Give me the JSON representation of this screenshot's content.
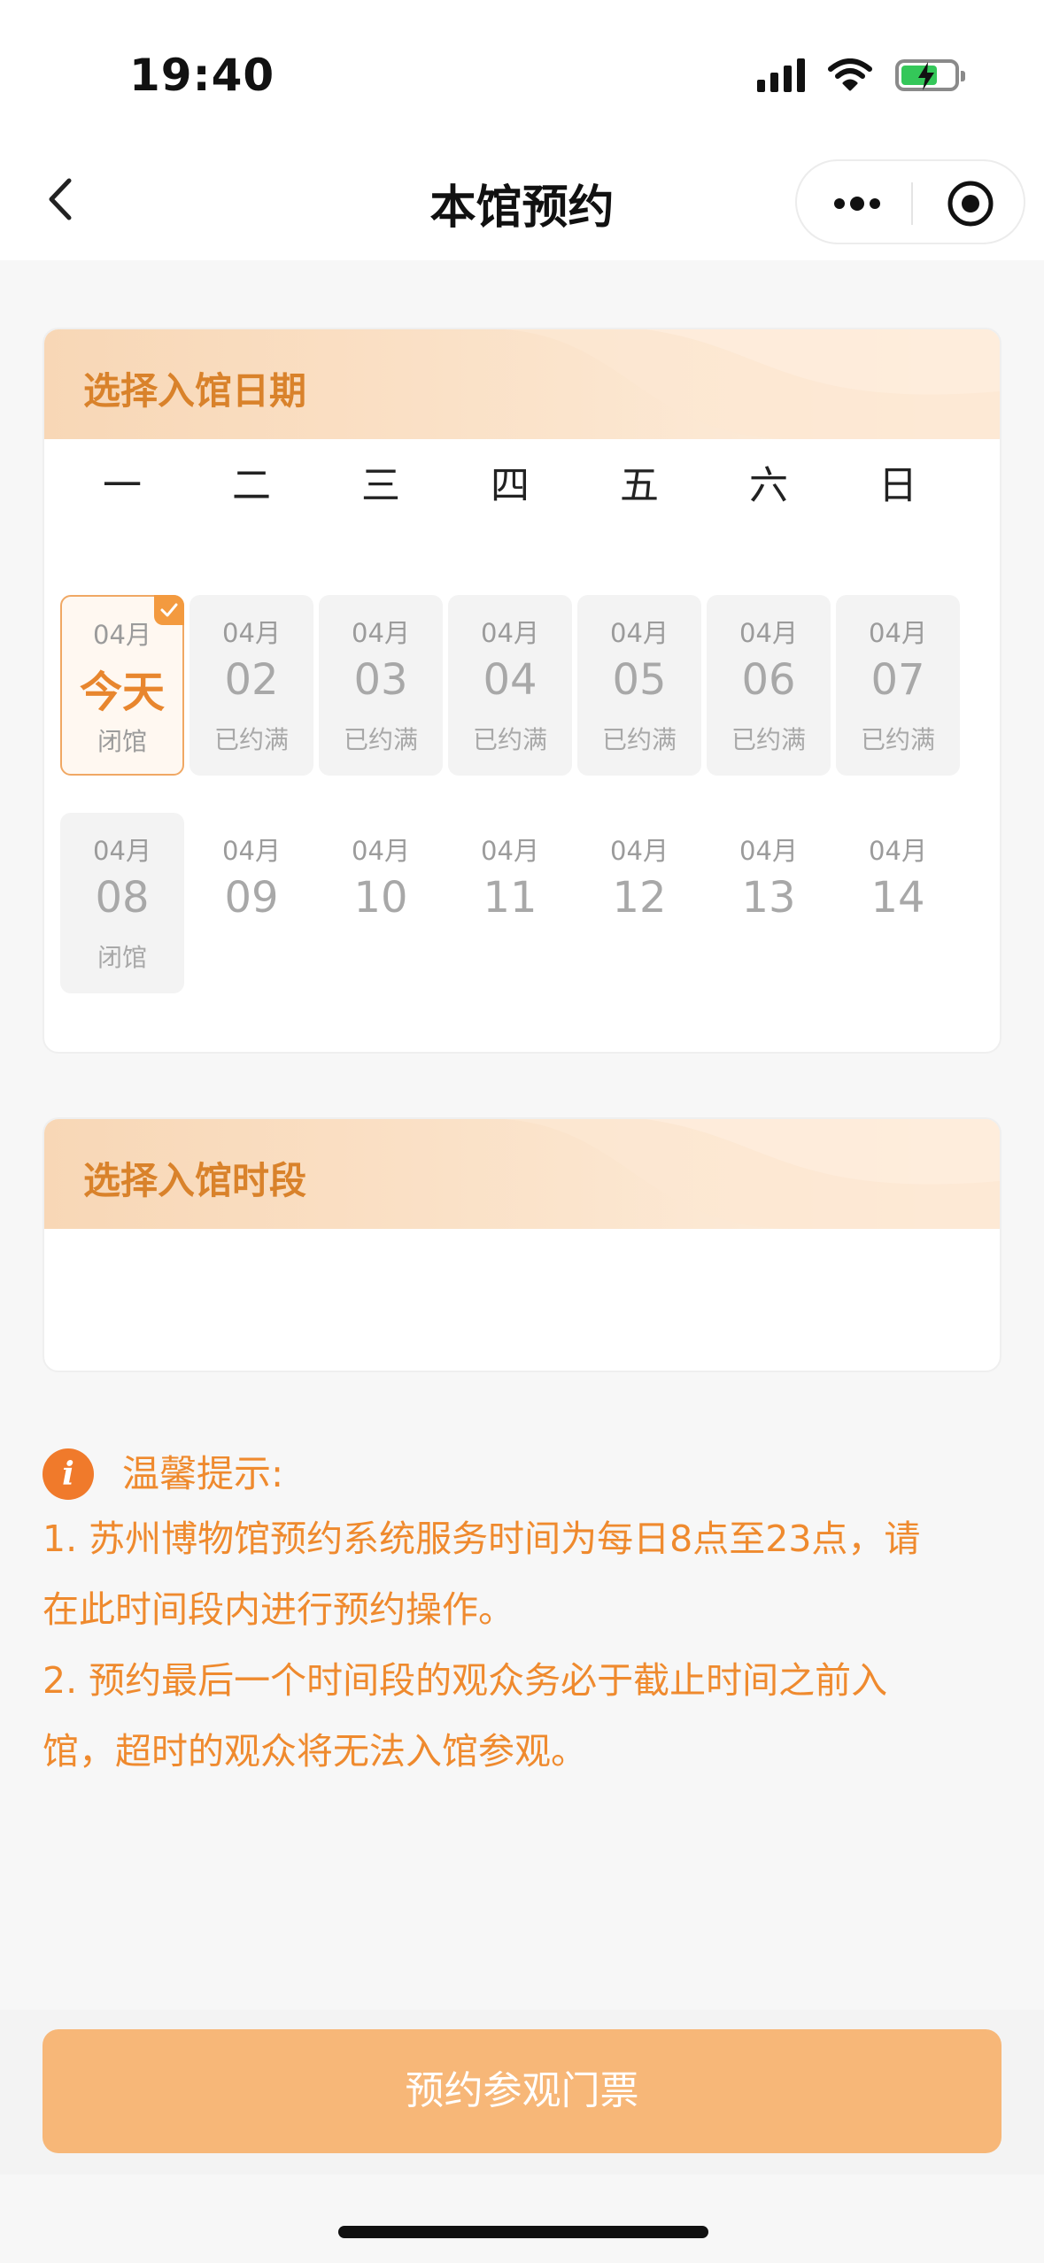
{
  "status_bar": {
    "time": "19:40"
  },
  "nav": {
    "title": "本馆预约"
  },
  "date_section": {
    "title": "选择入馆日期",
    "weekdays": [
      "一",
      "二",
      "三",
      "四",
      "五",
      "六",
      "日"
    ],
    "days": [
      {
        "month": "04月",
        "day": "今天",
        "status": "闭馆",
        "state": "selected"
      },
      {
        "month": "04月",
        "day": "02",
        "status": "已约满",
        "state": "full"
      },
      {
        "month": "04月",
        "day": "03",
        "status": "已约满",
        "state": "full"
      },
      {
        "month": "04月",
        "day": "04",
        "status": "已约满",
        "state": "full"
      },
      {
        "month": "04月",
        "day": "05",
        "status": "已约满",
        "state": "full"
      },
      {
        "month": "04月",
        "day": "06",
        "status": "已约满",
        "state": "full"
      },
      {
        "month": "04月",
        "day": "07",
        "status": "已约满",
        "state": "full"
      },
      {
        "month": "04月",
        "day": "08",
        "status": "闭馆",
        "state": "closed"
      },
      {
        "month": "04月",
        "day": "09",
        "status": "",
        "state": "unavailable"
      },
      {
        "month": "04月",
        "day": "10",
        "status": "",
        "state": "unavailable"
      },
      {
        "month": "04月",
        "day": "11",
        "status": "",
        "state": "unavailable"
      },
      {
        "month": "04月",
        "day": "12",
        "status": "",
        "state": "unavailable"
      },
      {
        "month": "04月",
        "day": "13",
        "status": "",
        "state": "unavailable"
      },
      {
        "month": "04月",
        "day": "14",
        "status": "",
        "state": "unavailable"
      }
    ]
  },
  "time_section": {
    "title": "选择入馆时段"
  },
  "tips": {
    "title": "温馨提示:",
    "lines": [
      "1. 苏州博物馆预约系统服务时间为每日8点至23点，请",
      "在此时间段内进行预约操作。",
      "2. 预约最后一个时间段的观众务必于截止时间之前入",
      "馆，超时的观众将无法入馆参观。"
    ]
  },
  "footer": {
    "button_label": "预约参观门票"
  },
  "colors": {
    "accent": "#ef8a2e",
    "title_orange": "#d9822b",
    "button": "#f7b778",
    "header_gradient_start": "#f8d7b6"
  }
}
